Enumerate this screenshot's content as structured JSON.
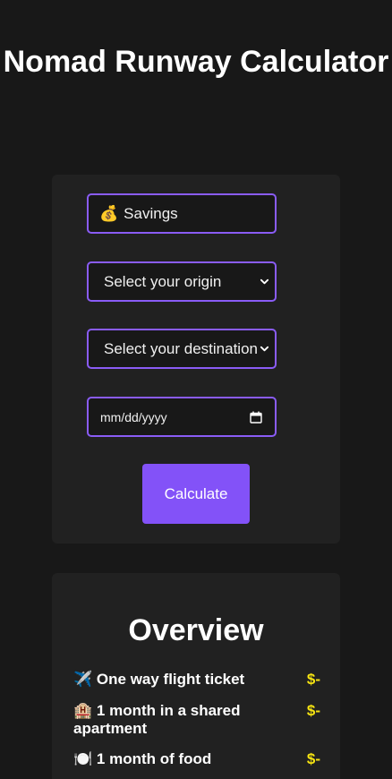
{
  "app": {
    "title": "Nomad Runway Calculator"
  },
  "form": {
    "savings": {
      "emoji": "💰",
      "placeholder": "Savings"
    },
    "origin": {
      "selected": "Select your origin"
    },
    "destination": {
      "selected": "Select your destination"
    },
    "date": {
      "value": "mm/dd/yyyy"
    },
    "calculate_label": "Calculate"
  },
  "overview": {
    "title": "Overview",
    "items": [
      {
        "emoji": "✈️",
        "label": "One way flight ticket",
        "value": "$-"
      },
      {
        "emoji": "🏨",
        "label": "1 month in a shared apartment",
        "value": "$-"
      },
      {
        "emoji": "🍽️",
        "label": "1 month of food",
        "value": "$-"
      }
    ]
  },
  "colors": {
    "background": "#181818",
    "card": "#212121",
    "accent": "#8352f8",
    "field_border": "#8a5cf6",
    "value_highlight": "#f5e311"
  }
}
